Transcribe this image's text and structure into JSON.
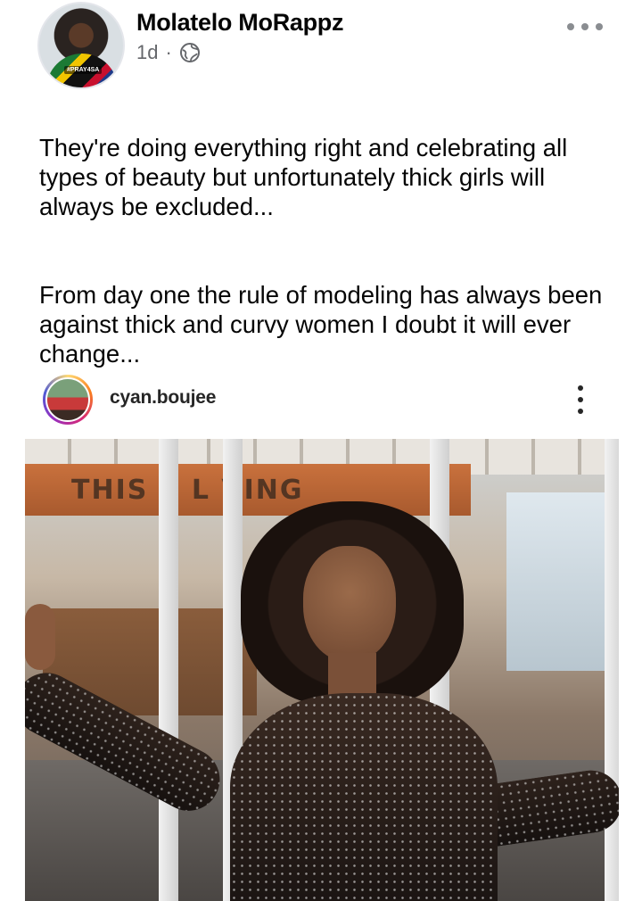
{
  "post": {
    "author_name": "Molatelo MoRappz",
    "time": "1d",
    "separator": "·",
    "audience_icon": "globe-icon",
    "avatar_tag": "#PRAY4SA",
    "more_icon": "more-horizontal-icon",
    "paragraphs": [
      "They're doing everything right and celebrating all types of beauty but unfortunately thick girls will always be excluded...",
      "From day one the rule of modeling has always been against thick and curvy women I doubt it will ever change..."
    ]
  },
  "shared_post": {
    "username": "cyan.boujee",
    "menu_icon": "more-vertical-icon",
    "photo_sign_text": "THIS  S L VING"
  },
  "colors": {
    "text_primary": "#050505",
    "text_secondary": "#65676b",
    "instagram_ring": "#d62976"
  }
}
